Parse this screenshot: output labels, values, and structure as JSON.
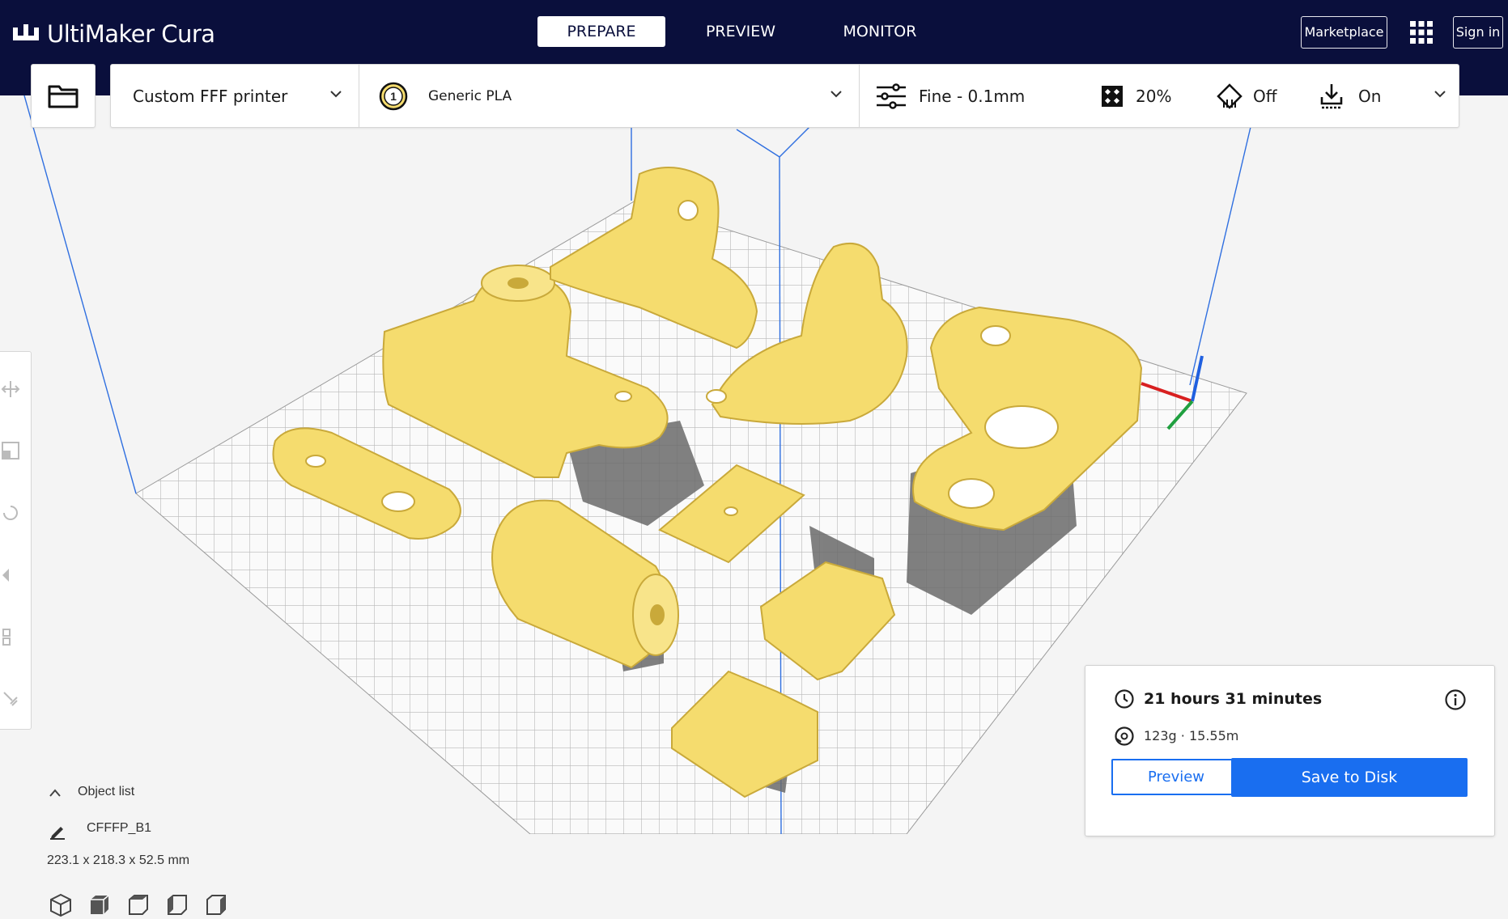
{
  "app": {
    "title": "UltiMaker Cura"
  },
  "stages": [
    {
      "label": "PREPARE",
      "active": true
    },
    {
      "label": "PREVIEW",
      "active": false
    },
    {
      "label": "MONITOR",
      "active": false
    }
  ],
  "header": {
    "marketplace_label": "Marketplace",
    "signin_label": "Sign in",
    "apps_icon": "grid-icon"
  },
  "toolbar": {
    "printer": "Custom FFF printer",
    "extruder_number": "1",
    "material": "Generic PLA",
    "profile": "Fine - 0.1mm",
    "infill": "20%",
    "support": "Off",
    "adhesion": "On"
  },
  "object_list": {
    "toggle_label": "Object list",
    "object_name": "CFFFP_B1",
    "dimensions": "223.1 x 218.3 x 52.5 mm"
  },
  "print_info": {
    "time": "21 hours 31 minutes",
    "material_usage": "123g · 15.55m",
    "preview_label": "Preview",
    "save_label": "Save to Disk"
  },
  "colors": {
    "header_bg": "#0a0f3c",
    "accent": "#196ef0",
    "model": "#f5dc6e",
    "build_volume": "#2f6fe0"
  }
}
